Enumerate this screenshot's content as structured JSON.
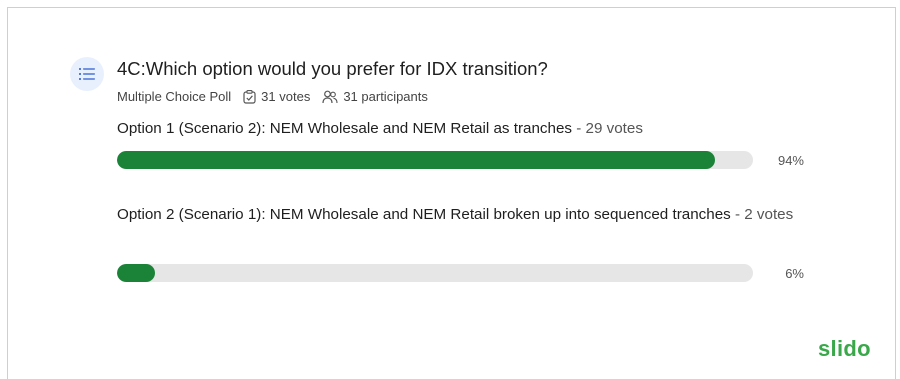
{
  "poll": {
    "question": "4C:Which option would you prefer for IDX transition?",
    "type_label": "Multiple Choice Poll",
    "votes_label": "31 votes",
    "participants_label": "31 participants",
    "icon": "list-icon",
    "accent_color": "#1b8338"
  },
  "options": [
    {
      "label": "Option 1 (Scenario 2): NEM Wholesale and NEM Retail as tranches",
      "votes": "- 29 votes",
      "percent_label": "94%",
      "percent": 94
    },
    {
      "label": "Option 2 (Scenario 1): NEM Wholesale and NEM Retail broken up into sequenced tranches",
      "votes": "- 2 votes",
      "percent_label": "6%",
      "percent": 6
    }
  ],
  "brand": {
    "logo_text": "slido",
    "color": "#3aa84a"
  }
}
